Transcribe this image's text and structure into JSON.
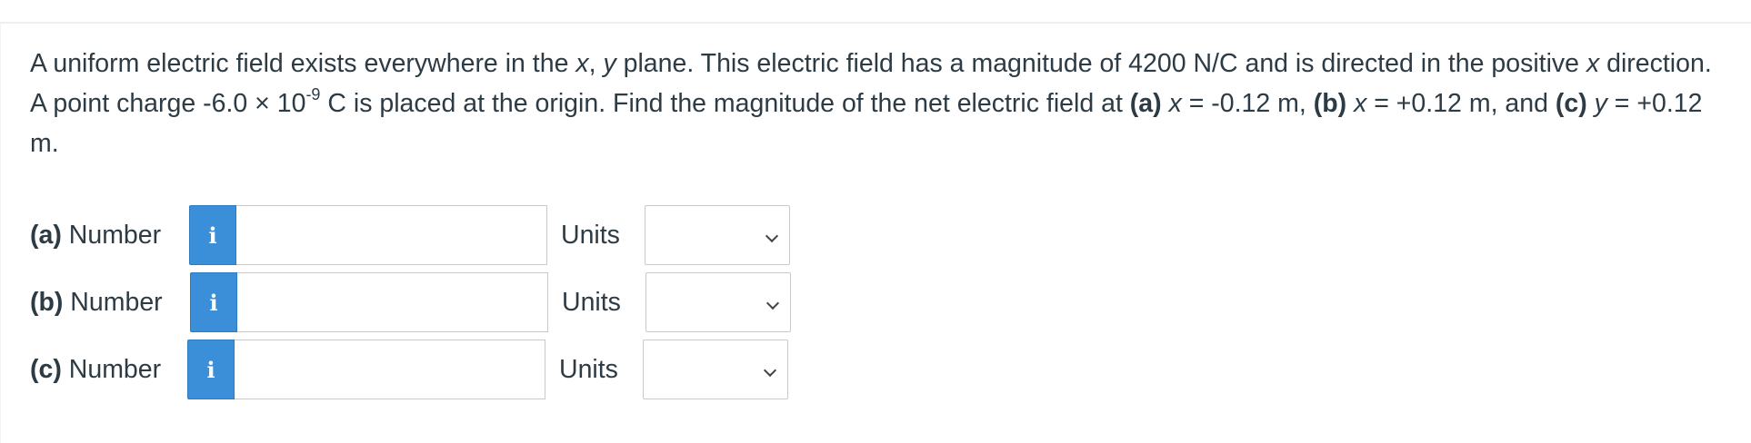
{
  "question": {
    "t1": "A uniform electric field exists everywhere in the ",
    "x1": "x",
    "t2": ", ",
    "y1": "y",
    "t3": " plane. This electric field has a magnitude of 4200 N/C and is directed in the positive ",
    "x2": "x",
    "t4": " direction. A point charge -6.0 × 10",
    "exp": "-9",
    "t5": " C is placed at the origin. Find the magnitude of the net electric field at ",
    "pa": "(a)",
    "t6": " ",
    "x3": "x",
    "t7": " = -0.12 m, ",
    "pb": "(b)",
    "t8": " ",
    "x4": "x",
    "t9": " = +0.12 m, and ",
    "pc": "(c)",
    "t10": " ",
    "y2": "y",
    "t11": " = +0.12 m."
  },
  "rows": [
    {
      "part": "(a)",
      "label": " Number",
      "info": "i",
      "value": "",
      "units_label": "Units",
      "units_value": ""
    },
    {
      "part": "(b)",
      "label": " Number",
      "info": "i",
      "value": "",
      "units_label": "Units",
      "units_value": ""
    },
    {
      "part": "(c)",
      "label": " Number",
      "info": "i",
      "value": "",
      "units_label": "Units",
      "units_value": ""
    }
  ],
  "colors": {
    "info_button": "#3b8fd9",
    "text": "#2d3b45",
    "border": "#c9c9c9"
  },
  "icons": {
    "info": "info-icon",
    "dropdown": "chevron-down-icon"
  }
}
